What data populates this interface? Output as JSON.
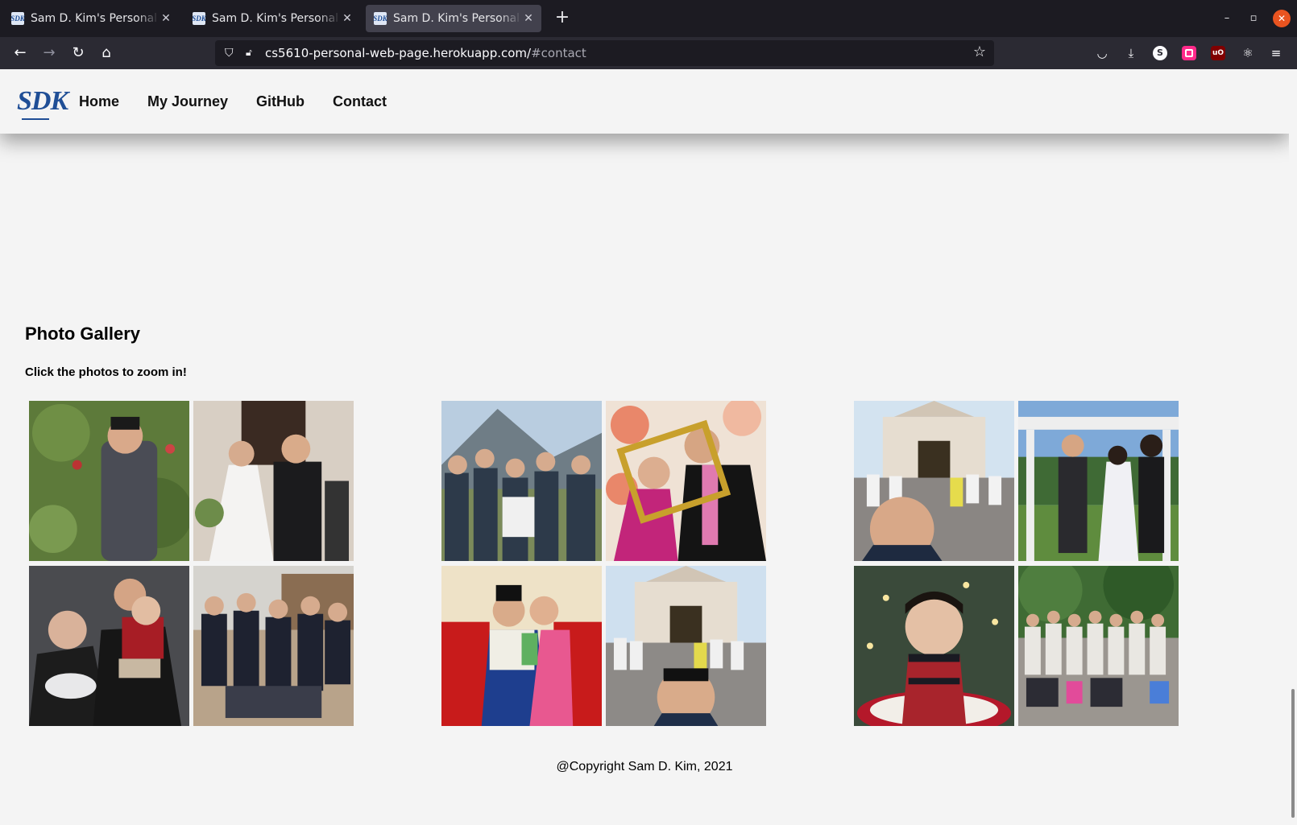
{
  "browser": {
    "tabs": [
      {
        "title": "Sam D. Kim's Personal Web Page",
        "favicon": "SDK",
        "active": false
      },
      {
        "title": "Sam D. Kim's Personal Web Page",
        "favicon": "SDK",
        "active": false
      },
      {
        "title": "Sam D. Kim's Personal Web Page",
        "favicon": "SDK",
        "active": true
      }
    ],
    "url_host": "cs5610-personal-web-page.herokuapp.com/",
    "url_hash": "#contact",
    "extensions": {
      "s_badge": "S",
      "ub_badge": "uO"
    }
  },
  "site": {
    "logo": "SDK",
    "nav": [
      "Home",
      "My Journey",
      "GitHub",
      "Contact"
    ],
    "gallery": {
      "title": "Photo Gallery",
      "subtitle": "Click the photos to zoom in!"
    },
    "footer": "@Copyright Sam D. Kim, 2021"
  }
}
